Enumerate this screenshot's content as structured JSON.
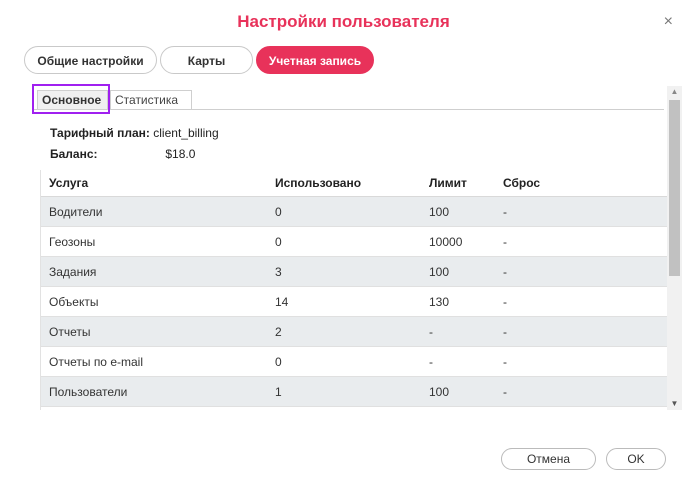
{
  "dialog": {
    "title": "Настройки пользователя",
    "close_symbol": "×"
  },
  "main_tabs": [
    {
      "label": "Общие настройки",
      "active": false
    },
    {
      "label": "Карты",
      "active": false
    },
    {
      "label": "Учетная запись",
      "active": true
    }
  ],
  "sub_tabs": [
    {
      "label": "Основное",
      "active": true
    },
    {
      "label": "Статистика",
      "active": false
    }
  ],
  "account": {
    "plan_label": "Тарифный план:",
    "plan_value": "client_billing",
    "balance_label": "Баланс:",
    "balance_value": "$18.0"
  },
  "table": {
    "headers": [
      "Услуга",
      "Использовано",
      "Лимит",
      "Сброс"
    ],
    "rows": [
      [
        "Водители",
        "0",
        "100",
        "-"
      ],
      [
        "Геозоны",
        "0",
        "10000",
        "-"
      ],
      [
        "Задания",
        "3",
        "100",
        "-"
      ],
      [
        "Объекты",
        "14",
        "130",
        "-"
      ],
      [
        "Отчеты",
        "2",
        "-",
        "-"
      ],
      [
        "Отчеты по e-mail",
        "0",
        "-",
        "-"
      ],
      [
        "Пользователи",
        "1",
        "100",
        "-"
      ]
    ]
  },
  "buttons": {
    "cancel": "Отмена",
    "ok": "OK"
  },
  "colors": {
    "accent": "#e8325a",
    "highlight_box": "#a020f0",
    "row_alt": "#e9ecee"
  },
  "icons": {
    "close": "close-icon",
    "scroll_up": "chevron-up-icon",
    "scroll_down": "chevron-down-icon"
  }
}
